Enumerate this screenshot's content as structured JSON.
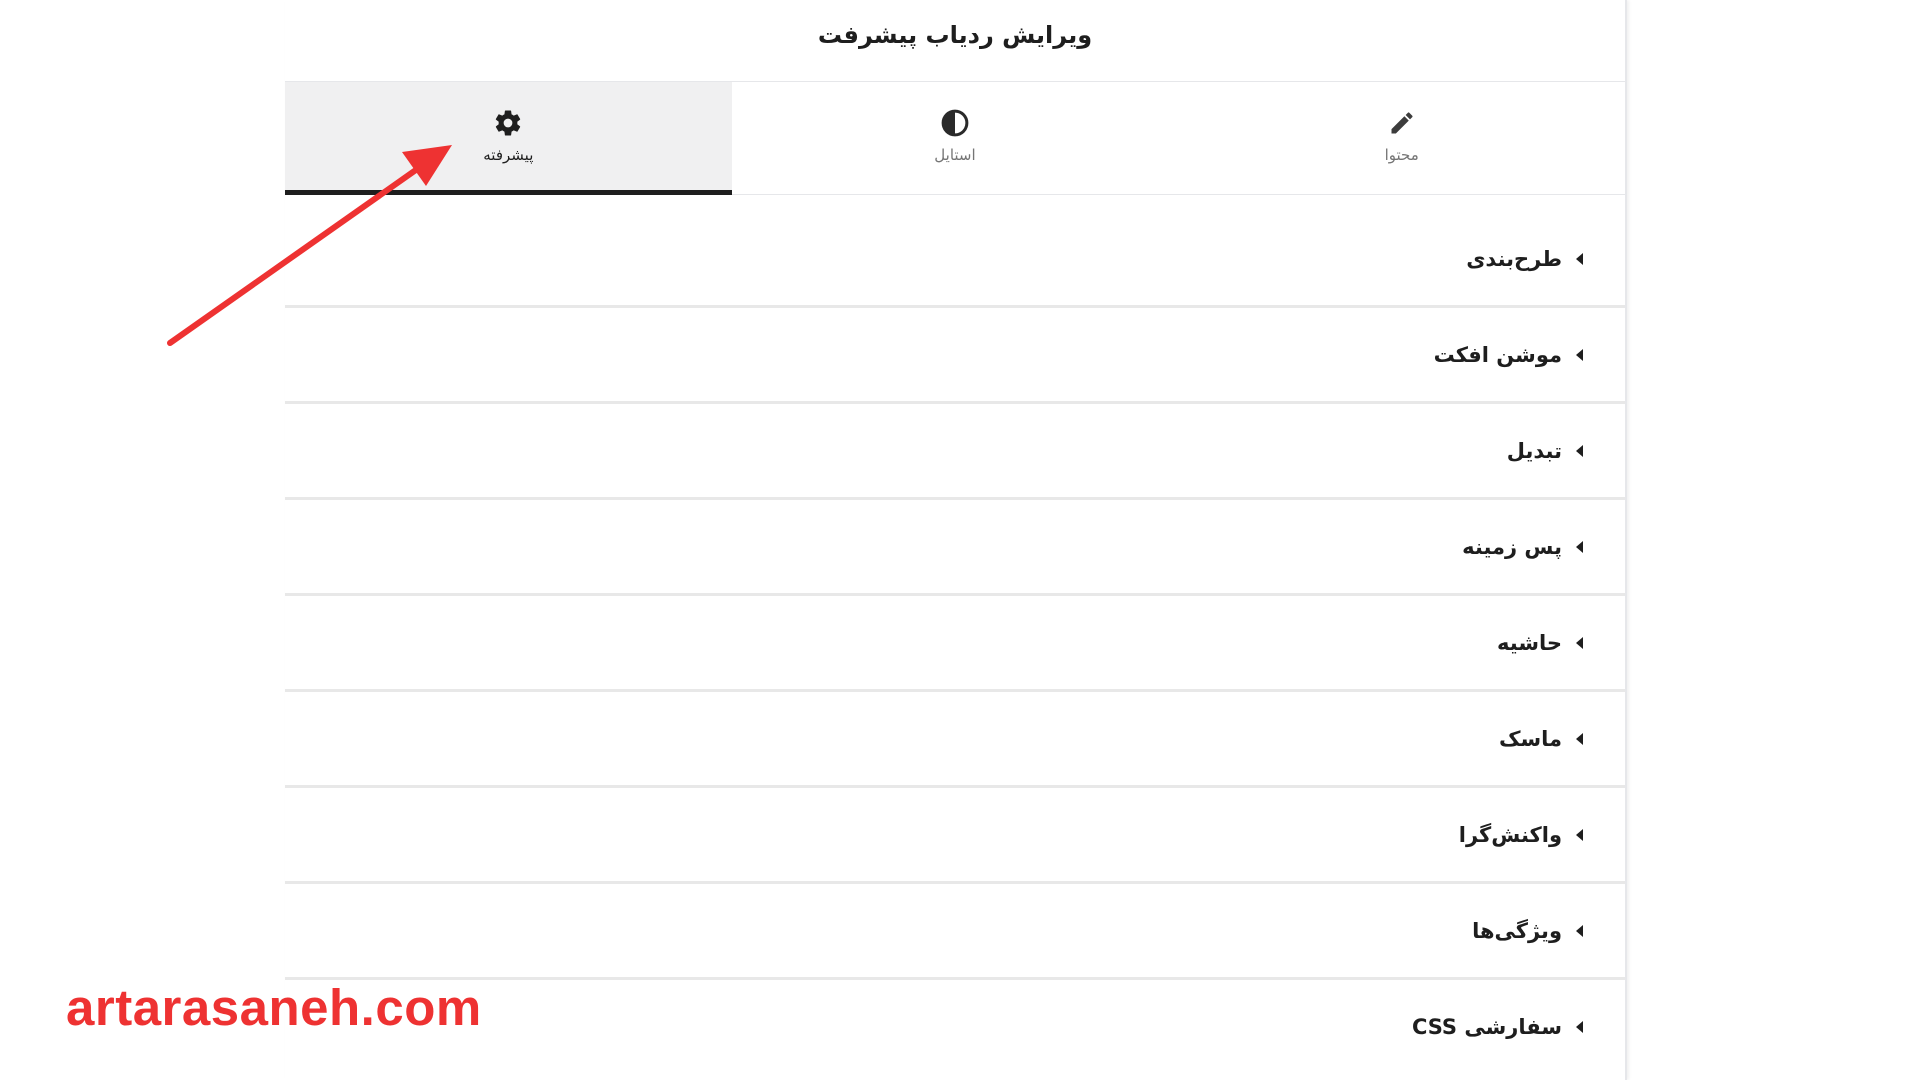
{
  "panel": {
    "title": "ویرایش ردیاب پیشرفت"
  },
  "tabs": [
    {
      "id": "content",
      "label": "محتوا",
      "icon": "pencil-icon",
      "active": false
    },
    {
      "id": "style",
      "label": "استایل",
      "icon": "contrast-icon",
      "active": false
    },
    {
      "id": "advanced",
      "label": "پیشرفته",
      "icon": "gear-icon",
      "active": true
    }
  ],
  "sections": [
    {
      "label": "طرح‌بندی"
    },
    {
      "label": "موشن افکت"
    },
    {
      "label": "تبدیل"
    },
    {
      "label": "پس زمینه"
    },
    {
      "label": "حاشیه"
    },
    {
      "label": "ماسک"
    },
    {
      "label": "واکنش‌گرا"
    },
    {
      "label": "ویژگی‌ها"
    },
    {
      "label": "CSS سفارشی"
    }
  ],
  "watermark": {
    "text": "artarasaneh.com"
  },
  "colors": {
    "accent": "#ee3232",
    "active_tab_bg": "#f0f0f1",
    "text": "#1e1e1e",
    "muted": "#757575"
  }
}
